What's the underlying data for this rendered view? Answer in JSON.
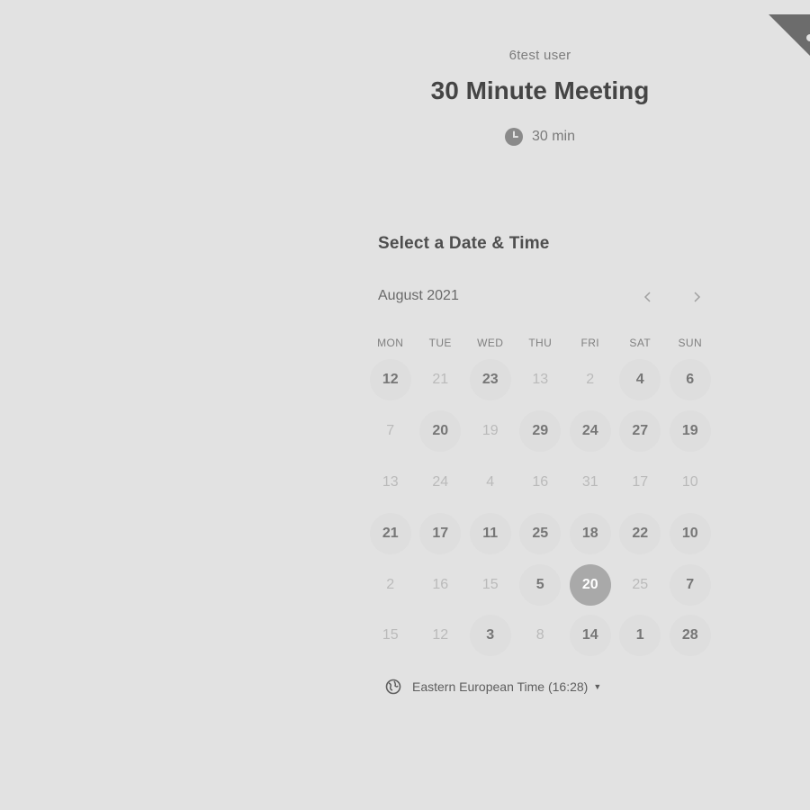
{
  "header": {
    "organizer": "6test user",
    "title": "30 Minute Meeting",
    "duration": "30 min"
  },
  "scheduler": {
    "section_title": "Select a Date & Time",
    "month_label": "August 2021",
    "prev_icon": "chevron-left-icon",
    "next_icon": "chevron-right-icon",
    "weekdays": [
      "MON",
      "TUE",
      "WED",
      "THU",
      "FRI",
      "SAT",
      "SUN"
    ],
    "days": [
      [
        "12",
        "available"
      ],
      [
        "21",
        "unavailable"
      ],
      [
        "23",
        "available"
      ],
      [
        "13",
        "unavailable"
      ],
      [
        "2",
        "unavailable"
      ],
      [
        "4",
        "available"
      ],
      [
        "6",
        "available"
      ],
      [
        "7",
        "unavailable"
      ],
      [
        "20",
        "available"
      ],
      [
        "19",
        "unavailable"
      ],
      [
        "29",
        "available"
      ],
      [
        "24",
        "available"
      ],
      [
        "27",
        "available"
      ],
      [
        "19",
        "available"
      ],
      [
        "13",
        "unavailable"
      ],
      [
        "24",
        "unavailable"
      ],
      [
        "4",
        "unavailable"
      ],
      [
        "16",
        "unavailable"
      ],
      [
        "31",
        "unavailable"
      ],
      [
        "17",
        "unavailable"
      ],
      [
        "10",
        "unavailable"
      ],
      [
        "21",
        "available"
      ],
      [
        "17",
        "available"
      ],
      [
        "11",
        "available"
      ],
      [
        "25",
        "available"
      ],
      [
        "18",
        "available"
      ],
      [
        "22",
        "available"
      ],
      [
        "10",
        "available"
      ],
      [
        "2",
        "unavailable"
      ],
      [
        "16",
        "unavailable"
      ],
      [
        "15",
        "unavailable"
      ],
      [
        "5",
        "available"
      ],
      [
        "20",
        "selected"
      ],
      [
        "25",
        "unavailable"
      ],
      [
        "7",
        "available"
      ],
      [
        "15",
        "unavailable"
      ],
      [
        "12",
        "unavailable"
      ],
      [
        "3",
        "available"
      ],
      [
        "8",
        "unavailable"
      ],
      [
        "14",
        "available"
      ],
      [
        "1",
        "available"
      ],
      [
        "28",
        "available"
      ]
    ],
    "timezone": "Eastern European Time (16:28)"
  },
  "colors": {
    "background": "#e2e2e2",
    "selected_day": "#a9a9a9",
    "available_day_bg": "#dedede",
    "ribbon": "#6c6c6c"
  }
}
